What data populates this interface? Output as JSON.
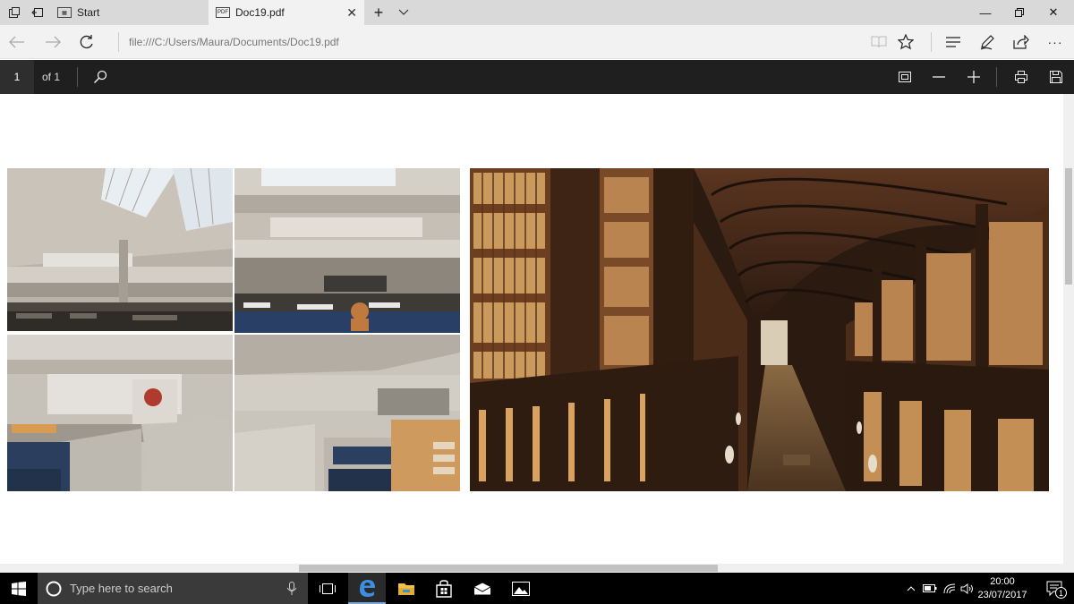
{
  "browser": {
    "tabs": [
      {
        "label": "Start"
      },
      {
        "label": "Doc19.pdf"
      }
    ],
    "address": "file:///C:/Users/Maura/Documents/Doc19.pdf",
    "buttons": {
      "back": "back-arrow",
      "forward": "forward-arrow",
      "refresh": "refresh",
      "reading_view": "book",
      "favorite": "star",
      "hub": "hub",
      "notes": "pen",
      "share": "share",
      "more": "···"
    }
  },
  "pdf_toolbar": {
    "page_number": "1",
    "page_of": "of 1",
    "tools": [
      "search",
      "fit-page",
      "zoom-out",
      "zoom-in",
      "print",
      "save"
    ]
  },
  "document": {
    "images": [
      {
        "subject": "concrete library atrium with skylights"
      },
      {
        "subject": "concrete library reading hall with desks"
      },
      {
        "subject": "concrete library interior with red circle"
      },
      {
        "subject": "concrete library with study carrels"
      },
      {
        "subject": "long room library with arched wooden ceiling and bookshelves"
      }
    ]
  },
  "taskbar": {
    "search_placeholder": "Type here to search",
    "time": "20:00",
    "date": "23/07/2017",
    "notification_count": "1",
    "accent": "#7aa7d6"
  }
}
